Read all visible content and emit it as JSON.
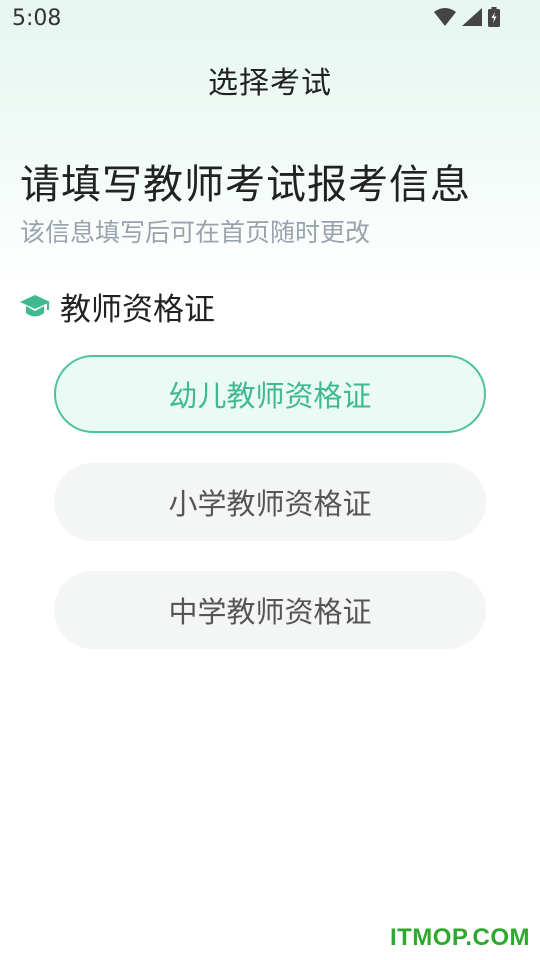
{
  "status_bar": {
    "time": "5:08",
    "icons": [
      "wifi-icon",
      "signal-icon",
      "battery-icon"
    ]
  },
  "header": {
    "title": "选择考试"
  },
  "main": {
    "heading": "请填写教师考试报考信息",
    "subheading": "该信息填写后可在首页随时更改",
    "section": {
      "icon": "graduation-cap-icon",
      "label": "教师资格证",
      "options": [
        {
          "label": "幼儿教师资格证",
          "selected": true
        },
        {
          "label": "小学教师资格证",
          "selected": false
        },
        {
          "label": "中学教师资格证",
          "selected": false
        }
      ]
    }
  },
  "watermark": "ITMOP.COM",
  "colors": {
    "accent": "#4cc398",
    "accent_text": "#3fb98d",
    "selected_bg": "#eafaf4",
    "option_bg": "#f4f6f5",
    "subtitle": "#9aa3ad",
    "watermark": "#2fa82f"
  }
}
